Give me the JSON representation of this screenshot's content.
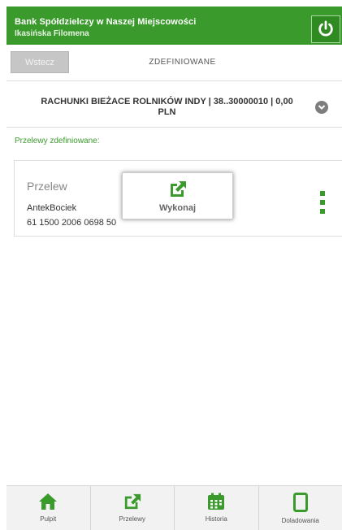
{
  "header": {
    "bank_name": "Bank Spółdzielczy w Naszej Miejscowości",
    "user_name": "Ikasińska Filomena"
  },
  "nav": {
    "back_label": "Wstecz",
    "title": "Zdefiniowane"
  },
  "account": {
    "line1": "RACHUNKI BIEŻACE ROLNIKÓW INDY | 38..30000010 | 0,00",
    "line2": "PLN"
  },
  "section_label": "Przelewy zdefiniowane:",
  "transfer": {
    "title": "Przelew",
    "recipient": "AntekBociek",
    "account": "61 1500 2006 0698 50"
  },
  "popup": {
    "label": "Wykonaj"
  },
  "bottom_nav": {
    "items": [
      {
        "label": "Pulpit",
        "icon": "home-icon"
      },
      {
        "label": "Przelewy",
        "icon": "external-link-icon"
      },
      {
        "label": "Historia",
        "icon": "calendar-icon"
      },
      {
        "label": "Doladowania",
        "icon": "phone-icon"
      }
    ]
  },
  "colors": {
    "brand": "#3a9a2c"
  }
}
